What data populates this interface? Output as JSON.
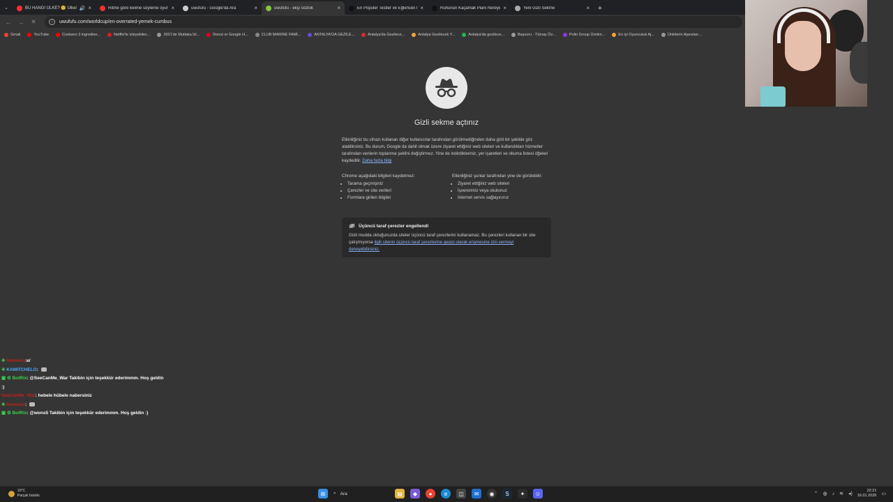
{
  "tabs": [
    {
      "title": "BU HANGİ ÜLKE? 🧐 Ülkeler",
      "favicon_color": "#ff2e2e",
      "sound": true,
      "active": false
    },
    {
      "title": "Ritme göre kelime söyleme oyunu",
      "favicon_color": "#ff2e2e",
      "active": false
    },
    {
      "title": "uwufufu - Google'da Ara",
      "favicon_color": "#cccccc",
      "active": false
    },
    {
      "title": "uwufufu - ekşi sözlük",
      "favicon_color": "#81c83b",
      "active": true
    },
    {
      "title": "En Popüler Testler ve Eğlenceli Oyunlar",
      "favicon_color": "#111111",
      "active": false
    },
    {
      "title": "Ruhunun Kaçamak Planı Nereye",
      "favicon_color": "#111111",
      "active": false
    },
    {
      "title": "Yeni Gizli Sekme",
      "favicon_color": "#aaaaaa",
      "active": false
    }
  ],
  "address": {
    "url": "uwufufu.com/worldcup/en-overrated-yemek-cumbus"
  },
  "bookmarks": [
    {
      "label": "Gmail",
      "color": "#ea4335"
    },
    {
      "label": "YouTube",
      "color": "#ff0000"
    },
    {
      "label": "Coolsers 3 ingredien...",
      "color": "#ff0000"
    },
    {
      "label": "Netflix'te izleyebilec...",
      "color": "#d81f26"
    },
    {
      "label": "2021'de Mutlaka İzl...",
      "color": "#999999"
    },
    {
      "label": "Donut or Google H...",
      "color": "#e60023"
    },
    {
      "label": "CLUB MARINE FAMİ...",
      "color": "#888888"
    },
    {
      "label": "ANTALYA'DA GEZİLE...",
      "color": "#6b4bd6"
    },
    {
      "label": "Antalya'da Gezilece...",
      "color": "#d32f2f"
    },
    {
      "label": "Antalya Gezilecek Y...",
      "color": "#f2a33a"
    },
    {
      "label": "Antalya'da gezilece...",
      "color": "#25b455"
    },
    {
      "label": "Başvuru - Tümay Öz...",
      "color": "#999999"
    },
    {
      "label": "Polin Group Üretim...",
      "color": "#8b3ad4"
    },
    {
      "label": "En iyi Oyunculuk Aj...",
      "color": "#f2a33a"
    },
    {
      "label": "Ünlülerin Ajansları...",
      "color": "#999999"
    }
  ],
  "incognito": {
    "heading": "Gizli sekme açtınız",
    "intro": "Etkinliğiniz bu cihazı kullanan diğer kullanıcılar tarafından görülmediğinden daha gizli bir şekilde göz atabilirsiniz. Bu durum, Google da dahil olmak üzere ziyaret ettiğiniz web siteleri ve kullandıkları hizmetler tarafından verilerin toplanma şeklini değiştirmez. Yine de indirdikleriniz, yer işaretleri ve okuma listesi öğeleri kaydedilir.",
    "learn_more": "Daha fazla bilgi",
    "col1_title": "Chrome aşağıdaki bilgileri kaydetmez:",
    "col1_items": [
      "Tarama geçmişiniz",
      "Çerezler ve site verileri",
      "Formlara girilen bilgiler"
    ],
    "col2_title": "Etkinliğiniz şunlar tarafından yine de görülebilir:",
    "col2_items": [
      "Ziyaret ettiğiniz web siteleri",
      "İşvereniniz veya okulunuz",
      "İnternet servis sağlayıcınız"
    ],
    "cookie_title": "Üçüncü taraf çerezler engellendi",
    "cookie_text": "Gizli modda olduğunuzda siteler üçüncü taraf çerezlerini kullanamaz. Bu çerezleri kullanan bir site çalışmıyorsa ",
    "cookie_link": "ilgili sitenin üçüncü taraf çerezlerine geçici olarak erişmesine izni vermeyi deneyebilirsiniz."
  },
  "chat": [
    {
      "user": "Nemesis",
      "user_color": "#c0201c",
      "text": ":e/",
      "badge": "plus"
    },
    {
      "user": "KAMITCHELO",
      "user_color": "#4aa9ff",
      "text": ":",
      "badge": "plus",
      "emote": true
    },
    {
      "user": "BotRix",
      "user_color": "#39d24f",
      "text": ": @SeeCanMe_War Takibin için teşekkür ederimmm. Hoş geldin",
      "text2": ":)",
      "badge": "bot"
    },
    {
      "user": "SeeCanMe_War",
      "user_color": "#c0201c",
      "text": ": hebele hübele nabersiniz",
      "badge": "none"
    },
    {
      "user": "Nemesis",
      "user_color": "#c0201c",
      "text": ":",
      "badge": "plus",
      "emote": true
    },
    {
      "user": "BotRix",
      "user_color": "#39d24f",
      "text": ": @wons5 Takibin için teşekkür ederimmm. Hoş geldin :)",
      "badge": "bot"
    }
  ],
  "taskbar": {
    "weather_temp": "10°C",
    "weather_desc": "Parçalı bulutlu",
    "search_label": "Ara",
    "time": "22:21",
    "date": "16.01.2026"
  }
}
